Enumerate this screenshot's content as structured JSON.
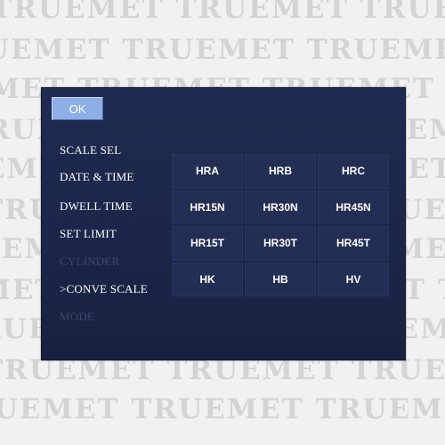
{
  "watermark": {
    "text": "TRUEMET"
  },
  "screen": {
    "ok_label": "OK",
    "menu": [
      {
        "label": "SCALE SEL",
        "enabled": true
      },
      {
        "label": "DATE & TIME",
        "enabled": true
      },
      {
        "label": "DWELL TIME",
        "enabled": true
      },
      {
        "label": "SET LIMIT",
        "enabled": true
      },
      {
        "label": "CYLINDER",
        "enabled": false
      },
      {
        "label": ">CONVE SCALE",
        "enabled": true
      },
      {
        "label": "MODE",
        "enabled": false
      }
    ],
    "scales": [
      [
        "HRA",
        "HRB",
        "HRC"
      ],
      [
        "HR15N",
        "HR30N",
        "HR45N"
      ],
      [
        "HR15T",
        "HR30T",
        "HR45T"
      ],
      [
        "HK",
        "HB",
        "HV"
      ]
    ]
  },
  "colors": {
    "screen_bg": "#1e2b50",
    "cell_bg": "#222e54",
    "ok_button": "#8eaee8",
    "disabled_text": "#3c4767",
    "text": "#ffffff"
  }
}
